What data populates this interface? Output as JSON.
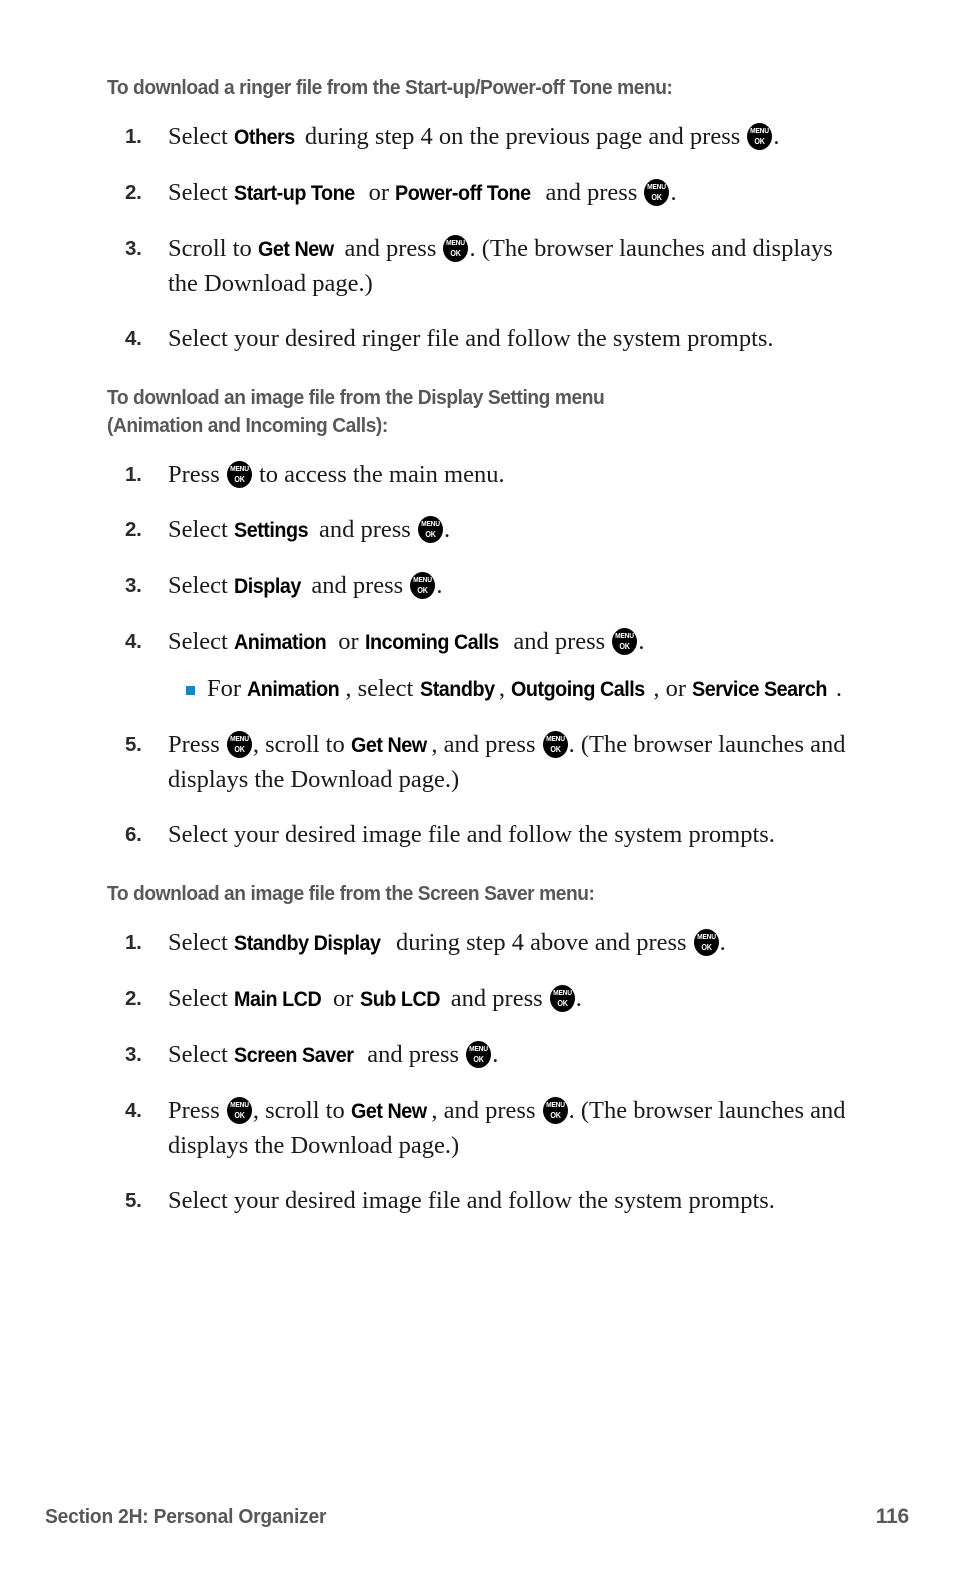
{
  "page": {
    "number": "116",
    "footer_section": "Section 2H: Personal Organizer"
  },
  "icons": {
    "menu_key": {
      "top": "MENU",
      "bottom": "OK"
    }
  },
  "colors": {
    "heading_gray": "#585858",
    "bullet_blue": "#1784c7",
    "body_text": "#1a1a1a",
    "key_icon": "#000000"
  },
  "sections": [
    {
      "heading": "To download a ringer file from the Start-up/Power-off Tone menu:",
      "steps": [
        {
          "number": "1.",
          "parts": [
            {
              "t": "text",
              "v": "Select "
            },
            {
              "t": "ui",
              "v": "Others"
            },
            {
              "t": "text",
              "v": " during step 4 on the previous page and press "
            },
            {
              "t": "key"
            },
            {
              "t": "text",
              "v": "."
            }
          ]
        },
        {
          "number": "2.",
          "parts": [
            {
              "t": "text",
              "v": "Select "
            },
            {
              "t": "ui",
              "v": "Start-up Tone"
            },
            {
              "t": "text",
              "v": " or "
            },
            {
              "t": "ui",
              "v": "Power-off Tone"
            },
            {
              "t": "text",
              "v": " and press "
            },
            {
              "t": "key"
            },
            {
              "t": "text",
              "v": "."
            }
          ]
        },
        {
          "number": "3.",
          "parts": [
            {
              "t": "text",
              "v": "Scroll to "
            },
            {
              "t": "ui",
              "v": "Get New"
            },
            {
              "t": "text",
              "v": " and press "
            },
            {
              "t": "key"
            },
            {
              "t": "text",
              "v": ". (The browser launches and displays the Download page.)"
            }
          ]
        },
        {
          "number": "4.",
          "parts": [
            {
              "t": "text",
              "v": "Select your desired ringer file and follow the system prompts."
            }
          ]
        }
      ]
    },
    {
      "heading": "To download an image file from the Display Setting menu\n(Animation and Incoming Calls):",
      "steps": [
        {
          "number": "1.",
          "parts": [
            {
              "t": "text",
              "v": "Press "
            },
            {
              "t": "key"
            },
            {
              "t": "text",
              "v": " to access the main menu."
            }
          ]
        },
        {
          "number": "2.",
          "parts": [
            {
              "t": "text",
              "v": "Select "
            },
            {
              "t": "ui",
              "v": "Settings"
            },
            {
              "t": "text",
              "v": " and press "
            },
            {
              "t": "key"
            },
            {
              "t": "text",
              "v": "."
            }
          ]
        },
        {
          "number": "3.",
          "parts": [
            {
              "t": "text",
              "v": "Select "
            },
            {
              "t": "ui",
              "v": "Display"
            },
            {
              "t": "text",
              "v": " and press "
            },
            {
              "t": "key"
            },
            {
              "t": "text",
              "v": "."
            }
          ]
        },
        {
          "number": "4.",
          "parts": [
            {
              "t": "text",
              "v": "Select "
            },
            {
              "t": "ui",
              "v": "Animation"
            },
            {
              "t": "text",
              "v": " or "
            },
            {
              "t": "ui",
              "v": "Incoming Calls"
            },
            {
              "t": "text",
              "v": " and press "
            },
            {
              "t": "key"
            },
            {
              "t": "text",
              "v": "."
            }
          ],
          "subitems": [
            {
              "parts": [
                {
                  "t": "text",
                  "v": "For "
                },
                {
                  "t": "ui",
                  "v": "Animation"
                },
                {
                  "t": "text",
                  "v": ", select "
                },
                {
                  "t": "ui",
                  "v": "Standby"
                },
                {
                  "t": "text",
                  "v": ", "
                },
                {
                  "t": "ui",
                  "v": "Outgoing Calls"
                },
                {
                  "t": "text",
                  "v": ", or "
                },
                {
                  "t": "ui",
                  "v": "Service Search"
                },
                {
                  "t": "text",
                  "v": "."
                }
              ]
            }
          ]
        },
        {
          "number": "5.",
          "parts": [
            {
              "t": "text",
              "v": "Press "
            },
            {
              "t": "key"
            },
            {
              "t": "text",
              "v": ", scroll to "
            },
            {
              "t": "ui",
              "v": "Get New"
            },
            {
              "t": "text",
              "v": ", and press "
            },
            {
              "t": "key"
            },
            {
              "t": "text",
              "v": ". (The browser launches and displays the Download page.)"
            }
          ]
        },
        {
          "number": "6.",
          "parts": [
            {
              "t": "text",
              "v": "Select your desired image file and follow the system prompts."
            }
          ]
        }
      ]
    },
    {
      "heading": "To download an image file from the Screen Saver menu:",
      "steps": [
        {
          "number": "1.",
          "parts": [
            {
              "t": "text",
              "v": "Select "
            },
            {
              "t": "ui",
              "v": "Standby Display"
            },
            {
              "t": "text",
              "v": " during step 4 above and press "
            },
            {
              "t": "key"
            },
            {
              "t": "text",
              "v": "."
            }
          ]
        },
        {
          "number": "2.",
          "parts": [
            {
              "t": "text",
              "v": "Select "
            },
            {
              "t": "ui",
              "v": "Main LCD"
            },
            {
              "t": "text",
              "v": " or "
            },
            {
              "t": "ui",
              "v": "Sub LCD"
            },
            {
              "t": "text",
              "v": " and press "
            },
            {
              "t": "key"
            },
            {
              "t": "text",
              "v": "."
            }
          ]
        },
        {
          "number": "3.",
          "parts": [
            {
              "t": "text",
              "v": "Select "
            },
            {
              "t": "ui",
              "v": "Screen Saver"
            },
            {
              "t": "text",
              "v": " and press "
            },
            {
              "t": "key"
            },
            {
              "t": "text",
              "v": "."
            }
          ]
        },
        {
          "number": "4.",
          "parts": [
            {
              "t": "text",
              "v": "Press "
            },
            {
              "t": "key"
            },
            {
              "t": "text",
              "v": ", scroll to "
            },
            {
              "t": "ui",
              "v": "Get New"
            },
            {
              "t": "text",
              "v": ", and press "
            },
            {
              "t": "key"
            },
            {
              "t": "text",
              "v": ". (The browser launches and displays the Download page.)"
            }
          ]
        },
        {
          "number": "5.",
          "parts": [
            {
              "t": "text",
              "v": "Select your desired image file and follow the system prompts."
            }
          ]
        }
      ]
    }
  ]
}
